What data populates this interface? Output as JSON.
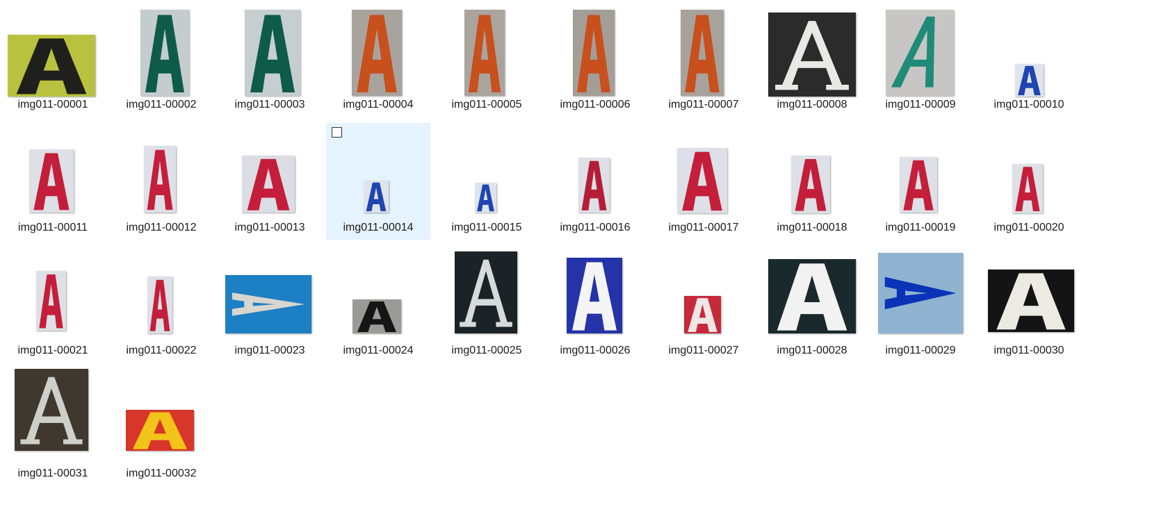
{
  "explorer": {
    "files": [
      {
        "name": "img011-00001",
        "bg": "#b9c23e",
        "fg": "#1f1f1c",
        "style": "sans",
        "selected": false
      },
      {
        "name": "img011-00002",
        "bg": "#c5ccce",
        "fg": "#0f5b4a",
        "style": "sans",
        "selected": false
      },
      {
        "name": "img011-00003",
        "bg": "#c7ced0",
        "fg": "#0f5b4a",
        "style": "sans",
        "selected": false
      },
      {
        "name": "img011-00004",
        "bg": "#a9a39d",
        "fg": "#c8501d",
        "style": "sans",
        "selected": false
      },
      {
        "name": "img011-00005",
        "bg": "#aaa49e",
        "fg": "#c8501d",
        "style": "sans",
        "selected": false
      },
      {
        "name": "img011-00006",
        "bg": "#a49e98",
        "fg": "#c8501d",
        "style": "sans",
        "selected": false
      },
      {
        "name": "img011-00007",
        "bg": "#a8a29c",
        "fg": "#c8501d",
        "style": "sans",
        "selected": false
      },
      {
        "name": "img011-00008",
        "bg": "#2b2b2b",
        "fg": "#e8e8e6",
        "style": "serif",
        "selected": false
      },
      {
        "name": "img011-00009",
        "bg": "#c8c6c4",
        "fg": "#1f8b78",
        "style": "italic",
        "selected": false
      },
      {
        "name": "img011-00010",
        "bg": "#dfe4ec",
        "fg": "#1f45b0",
        "style": "sans",
        "selected": false
      },
      {
        "name": "img011-00011",
        "bg": "#dde0e6",
        "fg": "#c41e3a",
        "style": "sans",
        "selected": false
      },
      {
        "name": "img011-00012",
        "bg": "#dde0e6",
        "fg": "#c41e3a",
        "style": "sans",
        "selected": false
      },
      {
        "name": "img011-00013",
        "bg": "#dadde3",
        "fg": "#c41e3a",
        "style": "sans",
        "selected": false
      },
      {
        "name": "img011-00014",
        "bg": "#dfe4ec",
        "fg": "#1f45b0",
        "style": "sans",
        "selected": true
      },
      {
        "name": "img011-00015",
        "bg": "#dfe4ec",
        "fg": "#1f45b0",
        "style": "sans",
        "selected": false
      },
      {
        "name": "img011-00016",
        "bg": "#dde0e6",
        "fg": "#b51d37",
        "style": "sans",
        "selected": false
      },
      {
        "name": "img011-00017",
        "bg": "#dde0e6",
        "fg": "#c41e3a",
        "style": "sans",
        "selected": false
      },
      {
        "name": "img011-00018",
        "bg": "#dde0e6",
        "fg": "#c41e3a",
        "style": "sans",
        "selected": false
      },
      {
        "name": "img011-00019",
        "bg": "#dde0e6",
        "fg": "#c41e3a",
        "style": "sans",
        "selected": false
      },
      {
        "name": "img011-00020",
        "bg": "#dde0e6",
        "fg": "#c41e3a",
        "style": "sans",
        "selected": false
      },
      {
        "name": "img011-00021",
        "bg": "#dde0e6",
        "fg": "#c41e3a",
        "style": "sans",
        "selected": false
      },
      {
        "name": "img011-00022",
        "bg": "#dde0e6",
        "fg": "#c41e3a",
        "style": "sans",
        "selected": false
      },
      {
        "name": "img011-00023",
        "bg": "#1d7fc4",
        "fg": "#d9d6cf",
        "style": "rotated",
        "selected": false
      },
      {
        "name": "img011-00024",
        "bg": "#9a9a98",
        "fg": "#151515",
        "style": "sans",
        "selected": false
      },
      {
        "name": "img011-00025",
        "bg": "#1b2326",
        "fg": "#d7dadb",
        "style": "serif",
        "selected": false
      },
      {
        "name": "img011-00026",
        "bg": "#2433a8",
        "fg": "#f4f4f4",
        "style": "sans",
        "selected": false
      },
      {
        "name": "img011-00027",
        "bg": "#c62a3a",
        "fg": "#f0e6e6",
        "style": "sans",
        "selected": false
      },
      {
        "name": "img011-00028",
        "bg": "#1a2a2c",
        "fg": "#f2f2f2",
        "style": "sans",
        "selected": false
      },
      {
        "name": "img011-00029",
        "bg": "#8fb3d0",
        "fg": "#0a33b8",
        "style": "rotated",
        "selected": false
      },
      {
        "name": "img011-00030",
        "bg": "#141414",
        "fg": "#ecebe3",
        "style": "sans",
        "selected": false
      },
      {
        "name": "img011-00031",
        "bg": "#3e382f",
        "fg": "#cfcfca",
        "style": "serif",
        "selected": false
      },
      {
        "name": "img011-00032",
        "bg": "#d8352b",
        "fg": "#f2c318",
        "style": "sans",
        "selected": false
      }
    ]
  }
}
